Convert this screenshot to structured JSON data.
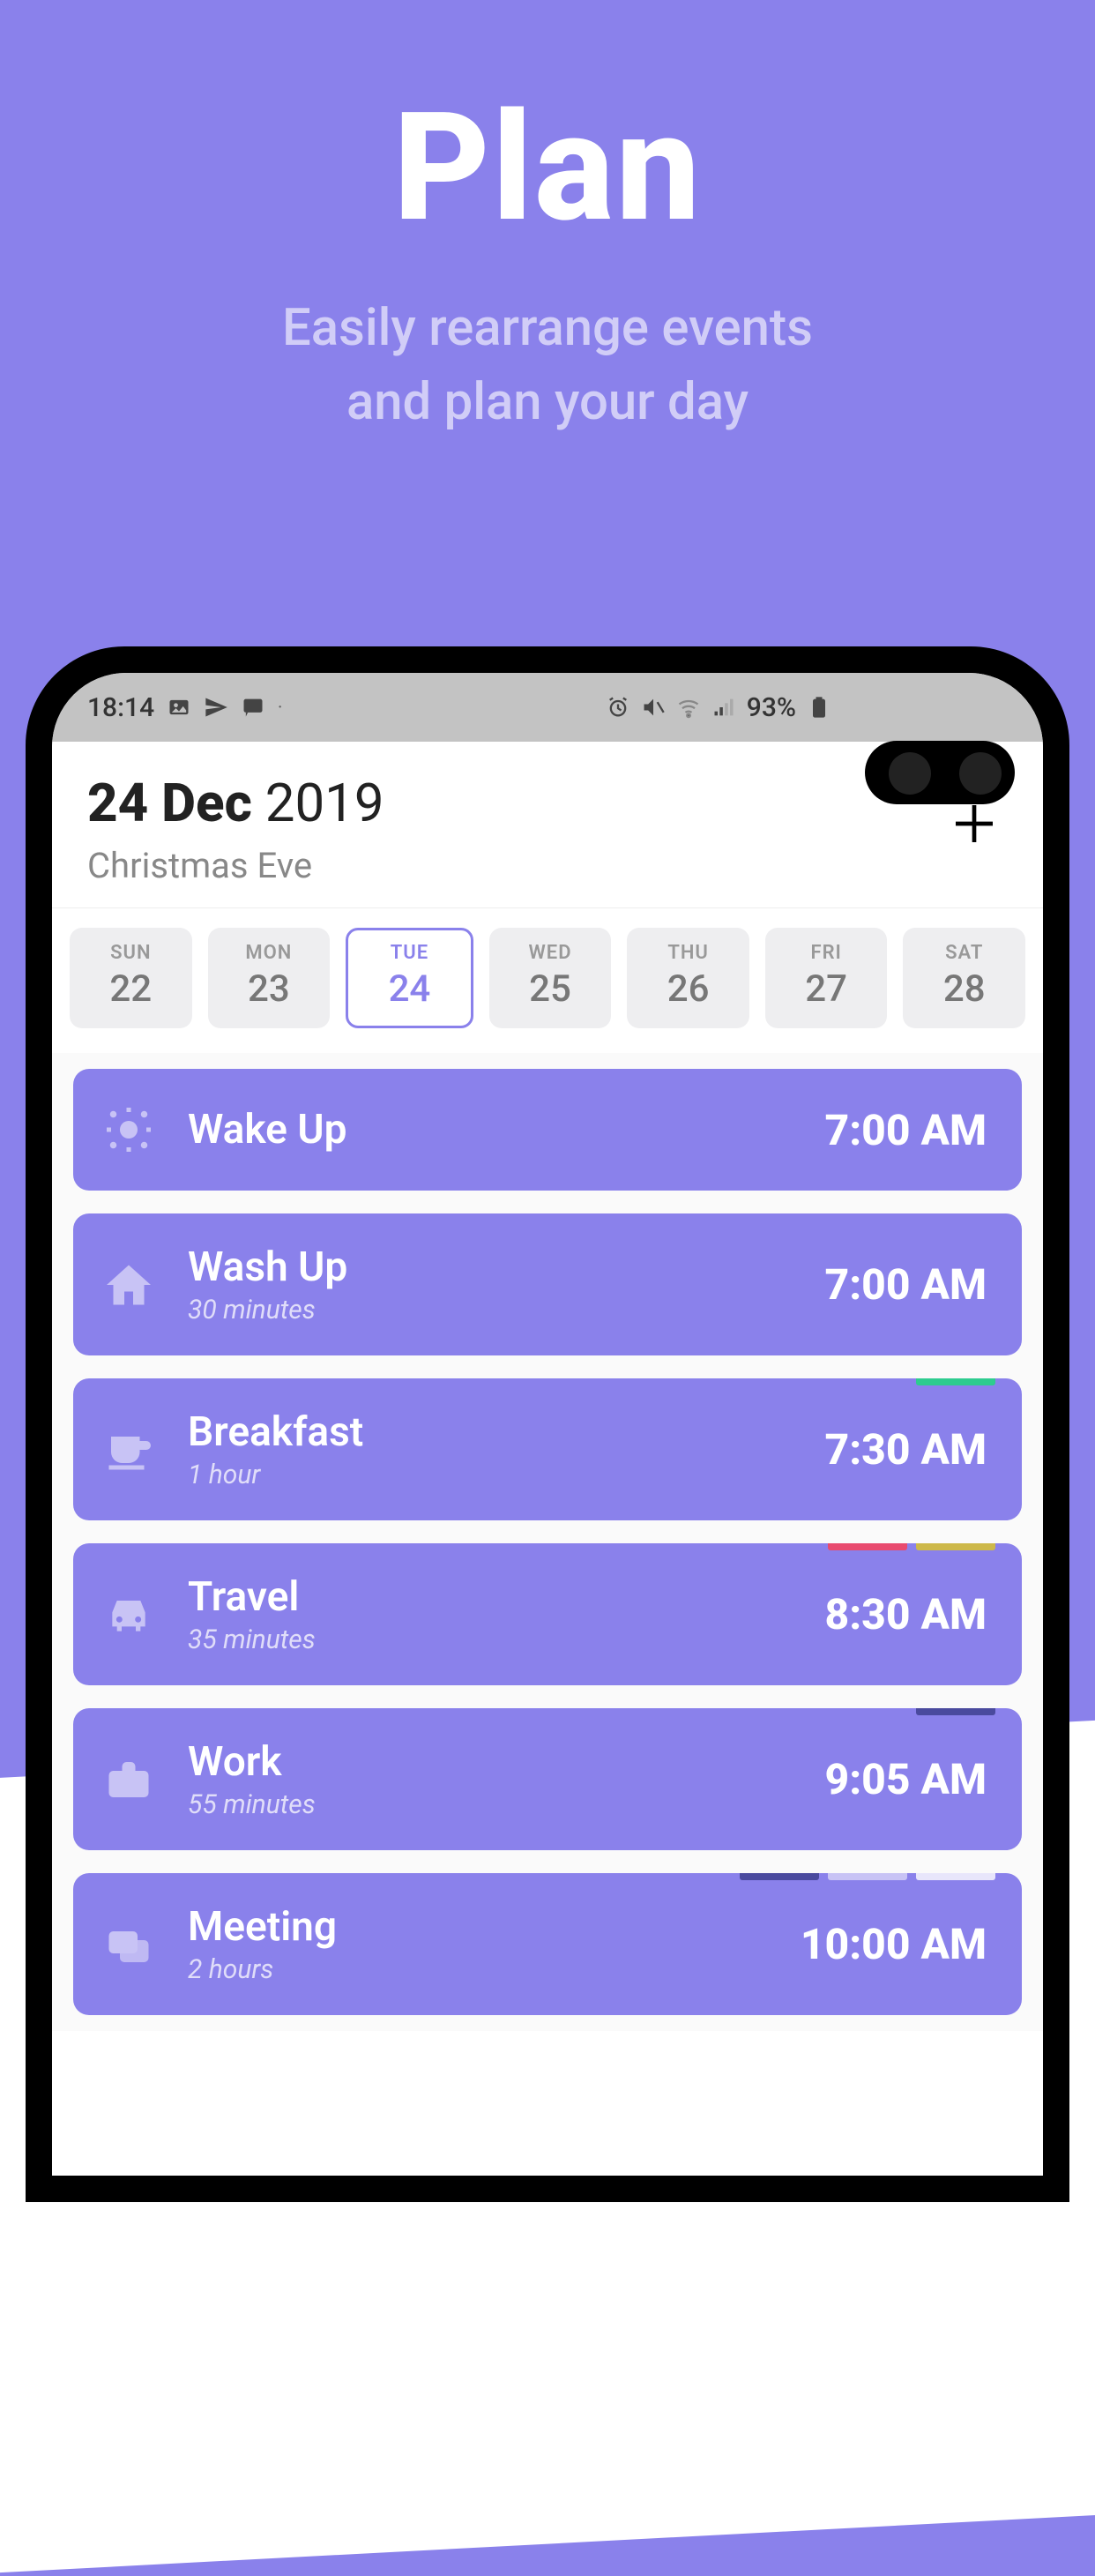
{
  "hero": {
    "title": "Plan",
    "subtitle_line1": "Easily rearrange events",
    "subtitle_line2": "and plan your day"
  },
  "statusbar": {
    "time": "18:14",
    "battery": "93%",
    "icons": [
      "picture-icon",
      "send-icon",
      "chat-icon",
      "alarm-icon",
      "mute-icon",
      "wifi-icon",
      "signal-icon",
      "battery-icon"
    ]
  },
  "header": {
    "day_month": "24 Dec",
    "year": "2019",
    "holiday": "Christmas Eve",
    "add_label": "+"
  },
  "week": [
    {
      "dow": "SUN",
      "num": "22",
      "selected": false
    },
    {
      "dow": "MON",
      "num": "23",
      "selected": false
    },
    {
      "dow": "TUE",
      "num": "24",
      "selected": true
    },
    {
      "dow": "WED",
      "num": "25",
      "selected": false
    },
    {
      "dow": "THU",
      "num": "26",
      "selected": false
    },
    {
      "dow": "FRI",
      "num": "27",
      "selected": false
    },
    {
      "dow": "SAT",
      "num": "28",
      "selected": false
    }
  ],
  "events": [
    {
      "icon": "sun-icon",
      "title": "Wake Up",
      "duration": "",
      "time": "7:00 AM",
      "tags": []
    },
    {
      "icon": "home-icon",
      "title": "Wash Up",
      "duration": "30 minutes",
      "time": "7:00 AM",
      "tags": []
    },
    {
      "icon": "cup-icon",
      "title": "Breakfast",
      "duration": "1 hour",
      "time": "7:30 AM",
      "tags": [
        "#2ecc8f"
      ]
    },
    {
      "icon": "car-icon",
      "title": "Travel",
      "duration": "35 minutes",
      "time": "8:30 AM",
      "tags": [
        "#e84a6f",
        "#cdb84a"
      ]
    },
    {
      "icon": "briefcase-icon",
      "title": "Work",
      "duration": "55 minutes",
      "time": "9:05 AM",
      "tags": [
        "#4a4a9e"
      ]
    },
    {
      "icon": "chat-icon",
      "title": "Meeting",
      "duration": "2 hours",
      "time": "10:00 AM",
      "tags": [
        "#4a4a9e",
        "#c8c3f5",
        "#e8e6fb"
      ]
    }
  ]
}
